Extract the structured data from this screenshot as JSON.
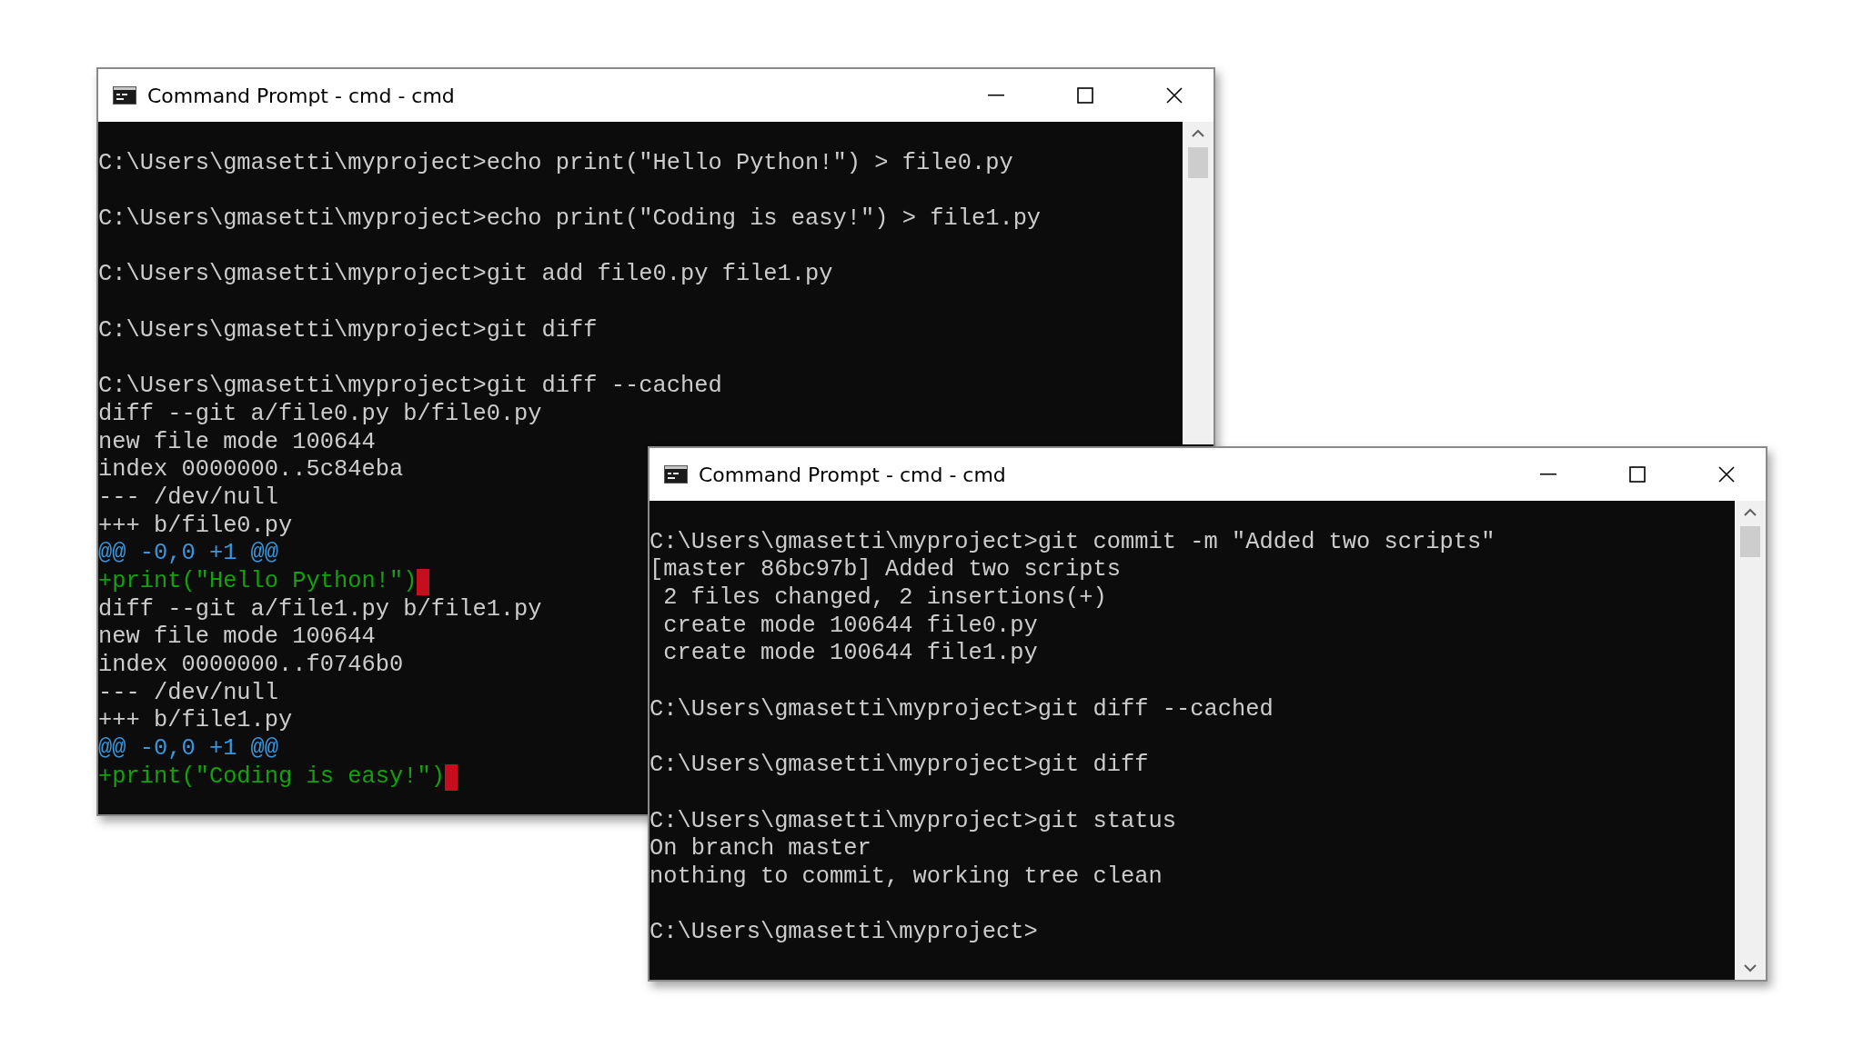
{
  "windows": [
    {
      "title": "Command Prompt - cmd - cmd",
      "lines": [
        {
          "kind": "blank",
          "cursor": false
        },
        {
          "kind": "plain",
          "text": "C:\\Users\\gmasetti\\myproject>echo print(\"Hello Python!\") > file0.py",
          "cursor": false
        },
        {
          "kind": "blank",
          "cursor": false
        },
        {
          "kind": "plain",
          "text": "C:\\Users\\gmasetti\\myproject>echo print(\"Coding is easy!\") > file1.py",
          "cursor": false
        },
        {
          "kind": "blank",
          "cursor": false
        },
        {
          "kind": "plain",
          "text": "C:\\Users\\gmasetti\\myproject>git add file0.py file1.py",
          "cursor": false
        },
        {
          "kind": "blank",
          "cursor": false
        },
        {
          "kind": "plain",
          "text": "C:\\Users\\gmasetti\\myproject>git diff",
          "cursor": false
        },
        {
          "kind": "blank",
          "cursor": false
        },
        {
          "kind": "plain",
          "text": "C:\\Users\\gmasetti\\myproject>git diff --cached",
          "cursor": false
        },
        {
          "kind": "plain",
          "text": "diff --git a/file0.py b/file0.py",
          "cursor": false
        },
        {
          "kind": "plain",
          "text": "new file mode 100644",
          "cursor": false
        },
        {
          "kind": "plain",
          "text": "index 0000000..5c84eba",
          "cursor": false
        },
        {
          "kind": "plain",
          "text": "--- /dev/null",
          "cursor": false
        },
        {
          "kind": "plain",
          "text": "+++ b/file0.py",
          "cursor": false
        },
        {
          "kind": "hunk",
          "text": "@@ -0,0 +1 @@",
          "cursor": false
        },
        {
          "kind": "added",
          "text": "+print(\"Hello Python!\")",
          "cursor": true
        },
        {
          "kind": "plain",
          "text": "diff --git a/file1.py b/file1.py",
          "cursor": false
        },
        {
          "kind": "plain",
          "text": "new file mode 100644",
          "cursor": false
        },
        {
          "kind": "plain",
          "text": "index 0000000..f0746b0",
          "cursor": false
        },
        {
          "kind": "plain",
          "text": "--- /dev/null",
          "cursor": false
        },
        {
          "kind": "plain",
          "text": "+++ b/file1.py",
          "cursor": false
        },
        {
          "kind": "hunk",
          "text": "@@ -0,0 +1 @@",
          "cursor": false
        },
        {
          "kind": "added",
          "text": "+print(\"Coding is easy!\")",
          "cursor": true
        }
      ]
    },
    {
      "title": "Command Prompt - cmd - cmd",
      "lines": [
        {
          "kind": "blank",
          "cursor": false
        },
        {
          "kind": "plain",
          "text": "C:\\Users\\gmasetti\\myproject>git commit -m \"Added two scripts\"",
          "cursor": false
        },
        {
          "kind": "plain",
          "text": "[master 86bc97b] Added two scripts",
          "cursor": false
        },
        {
          "kind": "plain",
          "text": " 2 files changed, 2 insertions(+)",
          "cursor": false
        },
        {
          "kind": "plain",
          "text": " create mode 100644 file0.py",
          "cursor": false
        },
        {
          "kind": "plain",
          "text": " create mode 100644 file1.py",
          "cursor": false
        },
        {
          "kind": "blank",
          "cursor": false
        },
        {
          "kind": "plain",
          "text": "C:\\Users\\gmasetti\\myproject>git diff --cached",
          "cursor": false
        },
        {
          "kind": "blank",
          "cursor": false
        },
        {
          "kind": "plain",
          "text": "C:\\Users\\gmasetti\\myproject>git diff",
          "cursor": false
        },
        {
          "kind": "blank",
          "cursor": false
        },
        {
          "kind": "plain",
          "text": "C:\\Users\\gmasetti\\myproject>git status",
          "cursor": false
        },
        {
          "kind": "plain",
          "text": "On branch master",
          "cursor": false
        },
        {
          "kind": "plain",
          "text": "nothing to commit, working tree clean",
          "cursor": false
        },
        {
          "kind": "blank",
          "cursor": false
        },
        {
          "kind": "plain",
          "text": "C:\\Users\\gmasetti\\myproject>",
          "cursor": false
        }
      ]
    }
  ]
}
